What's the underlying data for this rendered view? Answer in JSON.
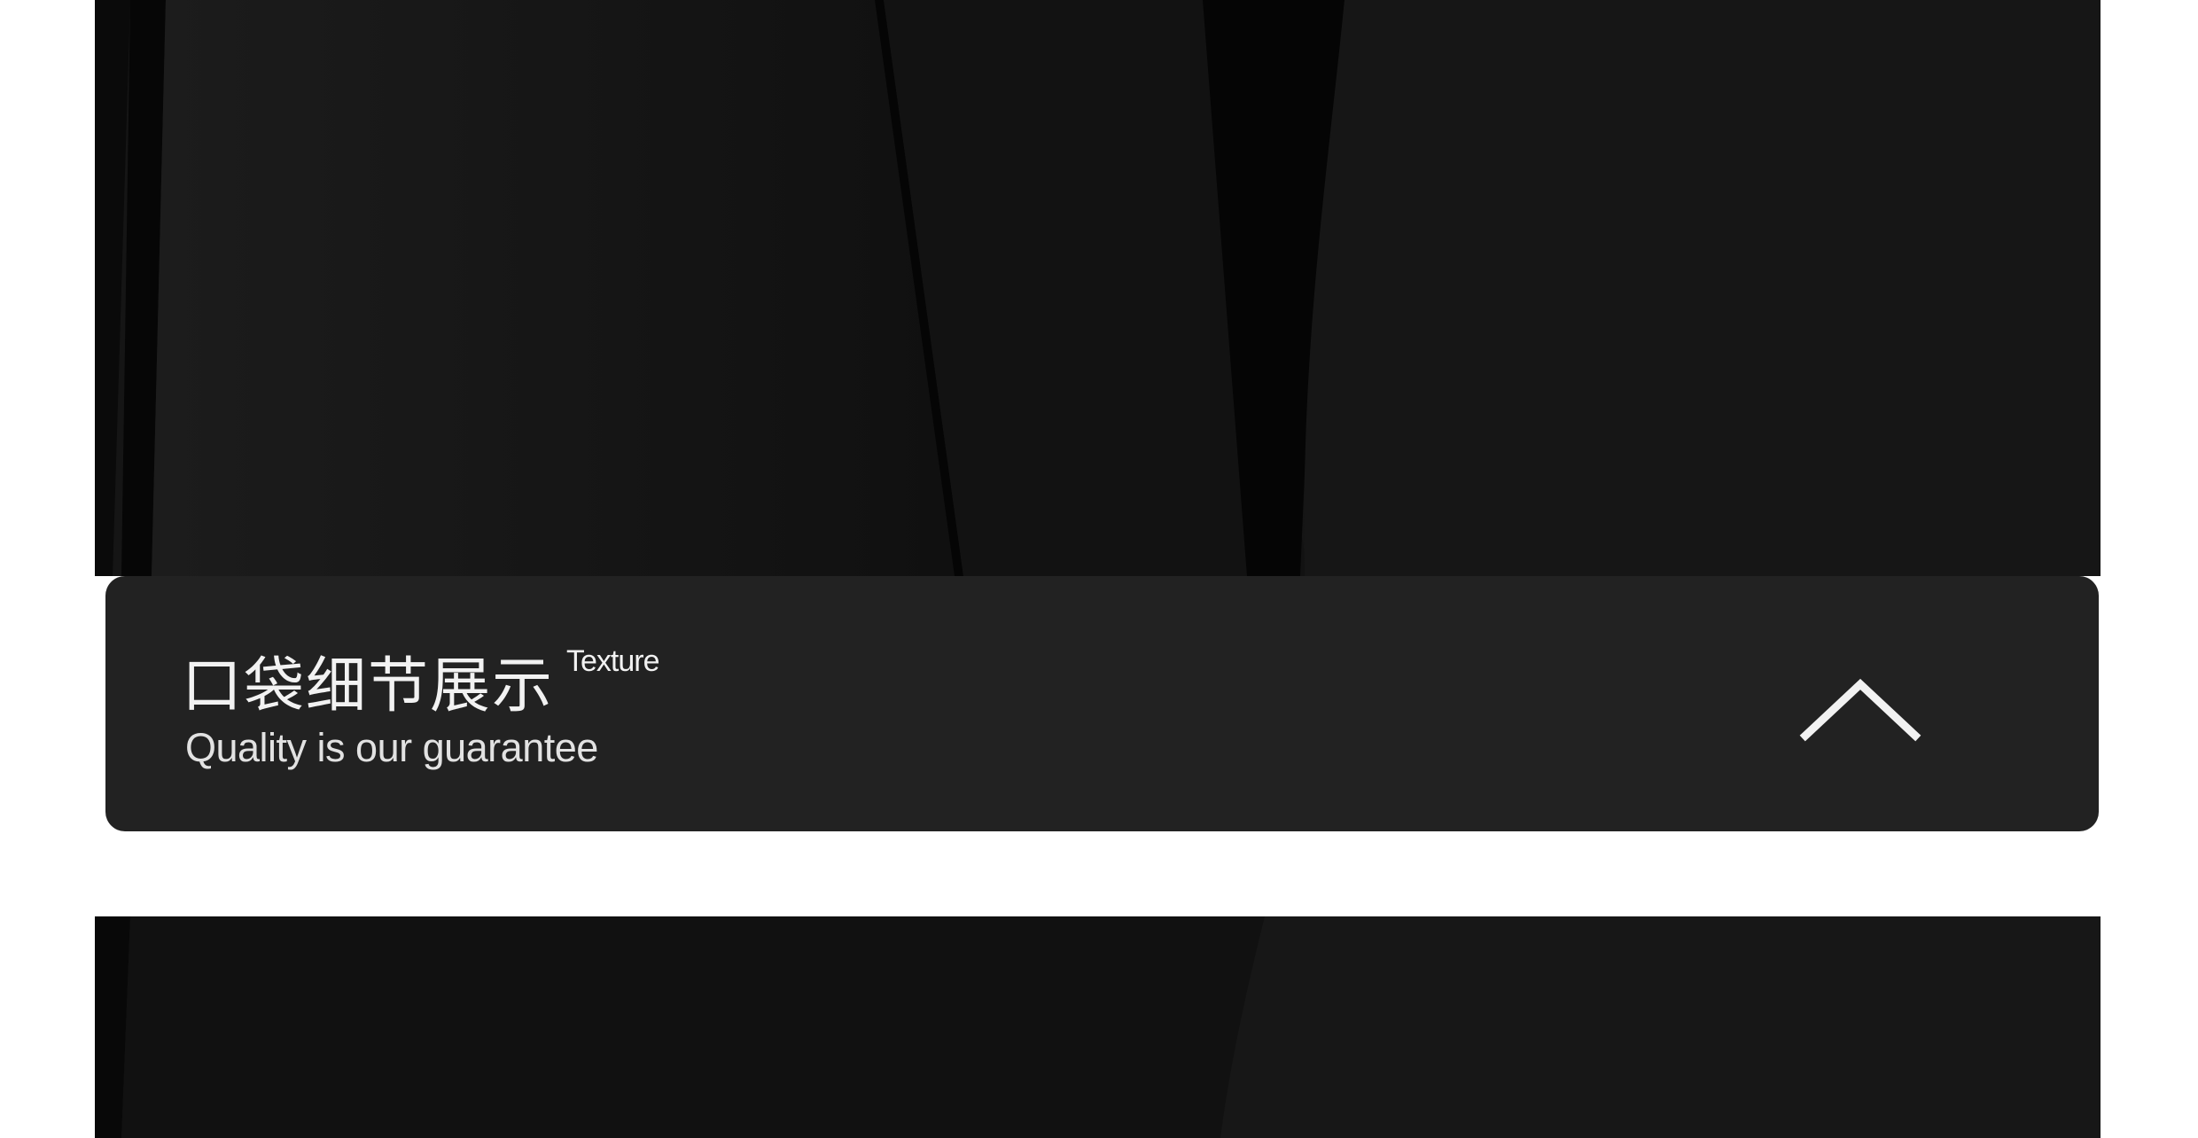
{
  "detail_section": {
    "title": "口袋细节展示",
    "title_superscript": "Texture",
    "subtitle": "Quality is our guarantee",
    "collapse_icon": "chevron-up-icon"
  },
  "colors": {
    "panel_background": "#222222",
    "text": "#f2f2f2",
    "fabric": "#141414",
    "page_background": "#ffffff"
  }
}
